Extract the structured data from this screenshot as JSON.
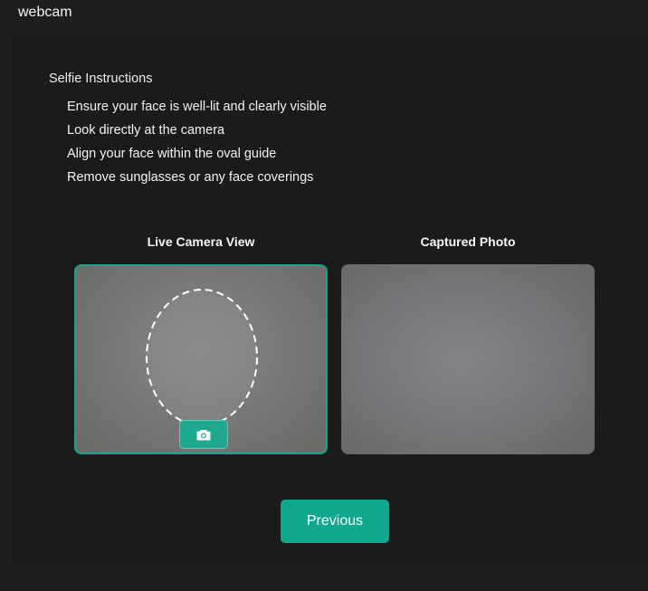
{
  "window": {
    "title": "webcam"
  },
  "instructions": {
    "heading": "Selfie Instructions",
    "items": [
      "Ensure your face is well-lit and clearly visible",
      "Look directly at the camera",
      "Align your face within the oval guide",
      "Remove sunglasses or any face coverings"
    ]
  },
  "camera": {
    "live_label": "Live Camera View",
    "captured_label": "Captured Photo",
    "capture_icon": "camera-icon",
    "guide_shape": "oval"
  },
  "navigation": {
    "previous_label": "Previous"
  },
  "colors": {
    "accent": "#0fa88e",
    "background": "#1e1e1e",
    "text": "#f2f2f2"
  }
}
